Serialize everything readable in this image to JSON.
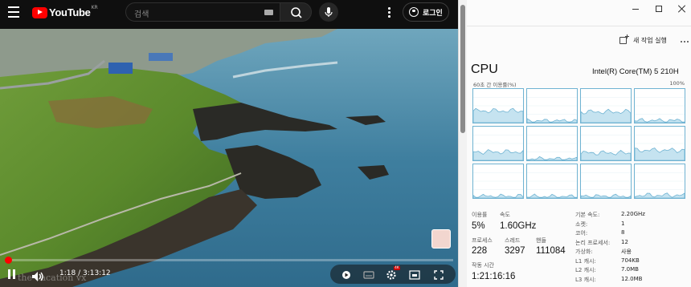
{
  "youtube": {
    "logo_text": "YouTube",
    "logo_region": "KR",
    "search_placeholder": "검색",
    "login_label": "로그인",
    "watermark": "the Vacation vx",
    "time_text": "1:18 / 3:13:12",
    "progress_fraction": 0.007,
    "settings_badge": "4K"
  },
  "task_manager": {
    "new_task_label": "새 작업 실행",
    "title": "CPU",
    "model": "Intel(R) Core(TM) 5 210H",
    "util_label": "60초 간 이용률(%)",
    "util_max": "100%",
    "graph_color": "#6fb3d2",
    "graph_fill": "#c5e3f0",
    "graphs": [
      {
        "level": 0.35
      },
      {
        "level": 0.05
      },
      {
        "level": 0.32
      },
      {
        "level": 0.06
      },
      {
        "level": 0.25
      },
      {
        "level": 0.04
      },
      {
        "level": 0.22
      },
      {
        "level": 0.3
      },
      {
        "level": 0.05
      },
      {
        "level": 0.04
      },
      {
        "level": 0.05
      },
      {
        "level": 0.08
      }
    ],
    "stats": {
      "usage_label": "이용률",
      "usage_value": "5%",
      "speed_label": "속도",
      "speed_value": "1.60GHz",
      "process_label": "프로세스",
      "process_value": "228",
      "thread_label": "스레드",
      "thread_value": "3297",
      "handle_label": "핸들",
      "handle_value": "111084",
      "uptime_label": "작동 시간",
      "uptime_value": "1:21:16:16"
    },
    "specs": [
      {
        "label": "기본 속도:",
        "value": "2.20GHz"
      },
      {
        "label": "소켓:",
        "value": "1"
      },
      {
        "label": "코어:",
        "value": "8"
      },
      {
        "label": "논리 프로세서:",
        "value": "12"
      },
      {
        "label": "가상화:",
        "value": "사용"
      },
      {
        "label": "L1 캐시:",
        "value": "704KB"
      },
      {
        "label": "L2 캐시:",
        "value": "7.0MB"
      },
      {
        "label": "L3 캐시:",
        "value": "12.0MB"
      }
    ]
  }
}
